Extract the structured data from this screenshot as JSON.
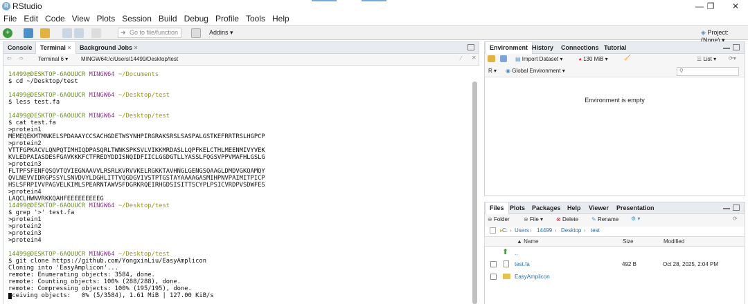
{
  "window": {
    "title": "RStudio",
    "controls": [
      "—",
      "❐",
      "✕"
    ]
  },
  "menu": [
    "File",
    "Edit",
    "Code",
    "View",
    "Plots",
    "Session",
    "Build",
    "Debug",
    "Profile",
    "Tools",
    "Help"
  ],
  "toolbar": {
    "goto_placeholder": "Go to file/function",
    "addins_label": "Addins",
    "project_label": "Project: (None)"
  },
  "left_pane": {
    "tabs": [
      "Console",
      "Terminal",
      "Background Jobs"
    ],
    "terminal_selector": "Terminal 6",
    "terminal_path": "MINGW64:/c/Users/14499/Desktop/test"
  },
  "terminal": {
    "user": "14499@DESKTOP-6AOUUCR",
    "env": "MINGW64",
    "lines": [
      {
        "type": "prompt",
        "path": "~/Documents"
      },
      {
        "type": "out",
        "text": "$ cd ~/Desktop/test"
      },
      {
        "type": "blank"
      },
      {
        "type": "prompt",
        "path": "~/Desktop/test"
      },
      {
        "type": "out",
        "text": "$ less test.fa"
      },
      {
        "type": "blank"
      },
      {
        "type": "prompt",
        "path": "~/Desktop/test"
      },
      {
        "type": "out",
        "text": "$ cat test.fa"
      },
      {
        "type": "out",
        "text": ">protein1"
      },
      {
        "type": "out",
        "text": "MEMEQEKMTMNKELSPDAAAYCCSACHGDETWSYNHPIRGRAKSRSLSASPALGSTKEFRRTRSLHGPCP"
      },
      {
        "type": "out",
        "text": ">protein2"
      },
      {
        "type": "out",
        "text": "VTTFGPKACVLQNPQTIMHIQDPASQRLTWNKSPKSVLVIKKMRDASLLQPFKELCTHLMEENMIVYVEK"
      },
      {
        "type": "out",
        "text": "KVLEDPAIASDESFGAVKKKFCTFREDYDDISNQIDFIICLGGDGTLLYASSLFQGSVPPVMAFHLGSLG"
      },
      {
        "type": "out",
        "text": ">protein3"
      },
      {
        "type": "out",
        "text": "FLTPFSFENFQSQVTQVIEGNAAVVLRSRLKVRVVKELRGKKTAVHNGLGENGSQAAGLDMDVGKQAMQY"
      },
      {
        "type": "out",
        "text": "QVLNEVVIDRGPSSYLSNVDVYLDGHLITTVQGDGVIVSTPTGSTAYAAAAGASMIHPNVPAIMITPICP"
      },
      {
        "type": "out",
        "text": "HSLSFRPIVVPAGVELKIMLSPEARNTAWVSFDGRKRQEIRHGDSISITTSCYPLPSICVRDPVSDWFES"
      },
      {
        "type": "out",
        "text": ">protein4"
      },
      {
        "type": "out",
        "text": "LAQCLHWNVRKKQAHFEEEEEEEEEG"
      },
      {
        "type": "prompt",
        "path": "~/Desktop/test"
      },
      {
        "type": "out",
        "text": "$ grep '>' test.fa"
      },
      {
        "type": "out",
        "text": ">protein1"
      },
      {
        "type": "out",
        "text": ">protein2"
      },
      {
        "type": "out",
        "text": ">protein3"
      },
      {
        "type": "out",
        "text": ">protein4"
      },
      {
        "type": "blank"
      },
      {
        "type": "prompt",
        "path": "~/Desktop/test"
      },
      {
        "type": "out",
        "text": "$ git clone https://github.com/YongxinLiu/EasyAmplicon"
      },
      {
        "type": "out",
        "text": "Cloning into 'EasyAmplicon'..."
      },
      {
        "type": "out",
        "text": "remote: Enumerating objects: 3584, done."
      },
      {
        "type": "out",
        "text": "remote: Counting objects: 100% (288/288), done."
      },
      {
        "type": "out",
        "text": "remote: Compressing objects: 100% (195/195), done."
      },
      {
        "type": "out",
        "text": "eceiving objects:   0% (5/3584), 1.61 MiB | 127.00 KiB/s"
      }
    ]
  },
  "env_pane": {
    "tabs": [
      "Environment",
      "History",
      "Connections",
      "Tutorial"
    ],
    "import_label": "Import Dataset",
    "memory_label": "130 MiB",
    "list_label": "List",
    "lang_label": "R",
    "scope_label": "Global Environment",
    "empty_text": "Environment is empty"
  },
  "files_pane": {
    "tabs": [
      "Files",
      "Plots",
      "Packages",
      "Help",
      "Viewer",
      "Presentation"
    ],
    "buttons": [
      "Folder",
      "File",
      "Delete",
      "Rename"
    ],
    "breadcrumb": [
      "C:",
      "Users",
      "14499",
      "Desktop",
      "test"
    ],
    "columns": [
      "Name",
      "Size",
      "Modified"
    ],
    "files": [
      {
        "name": "..",
        "size": "",
        "modified": ""
      },
      {
        "name": "test.fa",
        "size": "492 B",
        "modified": "Oct 28, 2025, 2:04 PM"
      },
      {
        "name": "EasyAmplicon",
        "size": "",
        "modified": ""
      }
    ]
  },
  "colors": {
    "accent": "#75aadb",
    "prompt_user": "#6b8e23",
    "prompt_env": "#8b3a8b",
    "prompt_path": "#999900"
  }
}
